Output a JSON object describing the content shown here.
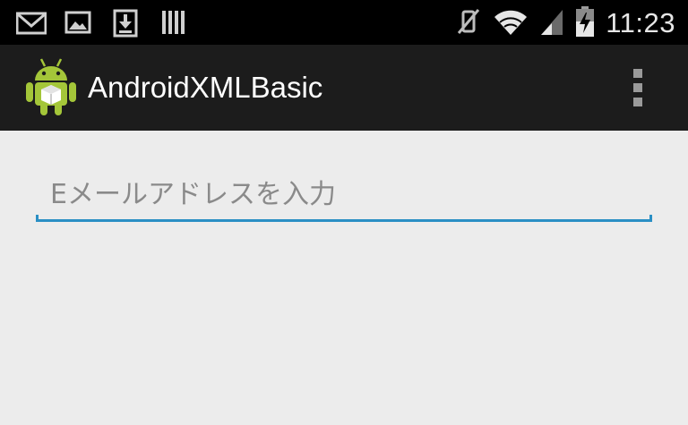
{
  "status_bar": {
    "time": "11:23",
    "left_icons": [
      "gmail-icon",
      "gallery-icon",
      "download-icon",
      "storage-icon"
    ],
    "right_icons": [
      "mute-icon",
      "wifi-icon",
      "signal-icon",
      "battery-charging-icon"
    ]
  },
  "action_bar": {
    "app_title": "AndroidXMLBasic",
    "app_icon": "android-icon",
    "overflow_icon": "overflow-menu-icon"
  },
  "form": {
    "email": {
      "value": "",
      "placeholder": "Eメールアドレスを入力"
    }
  },
  "colors": {
    "status_bar_bg": "#000000",
    "action_bar_bg": "#1c1c1c",
    "content_bg": "#ececec",
    "accent": "#2a8fc4",
    "android_green": "#a4c639"
  }
}
